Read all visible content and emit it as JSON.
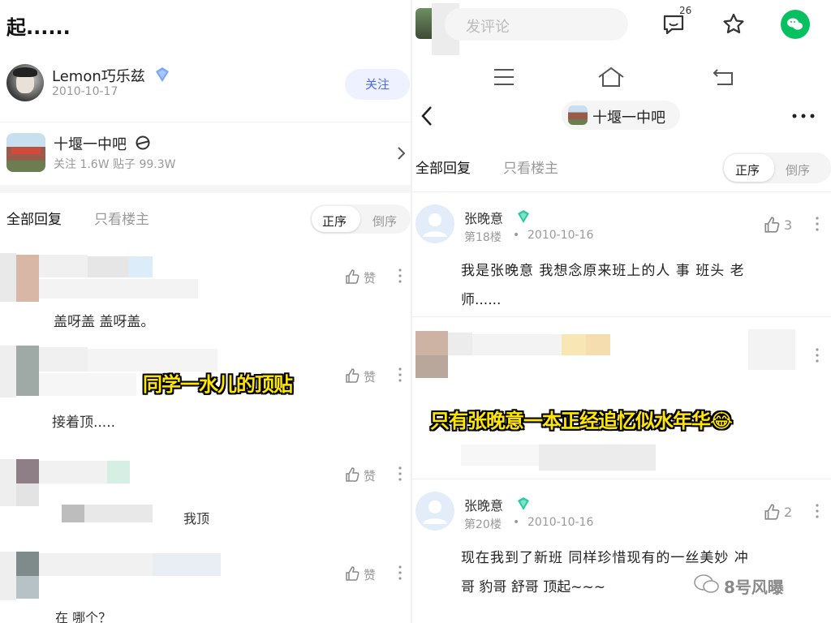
{
  "left": {
    "top_text": "起......",
    "author": {
      "name": "Lemon巧乐兹",
      "date": "2010-10-17",
      "follow_label": "关注"
    },
    "forum": {
      "name": "十堰一中吧",
      "stats": "关注 1.6W  贴子 99.3W"
    },
    "filters": {
      "all": "全部回复",
      "owner_only": "只看楼主",
      "order_asc": "正序",
      "order_desc": "倒序"
    },
    "comments": [
      {
        "text": "盖呀盖 盖呀盖。",
        "like": "赞"
      },
      {
        "text": "接着顶.....",
        "like": "赞"
      },
      {
        "text": "我顶",
        "like": "赞"
      },
      {
        "text": "在 哪个？",
        "like": "赞"
      }
    ],
    "overlay_caption": "同学一水儿的顶贴"
  },
  "right": {
    "comment_box_placeholder": "发评论",
    "comment_badge": "26",
    "forum_title": "十堰一中吧",
    "filters": {
      "all": "全部回复",
      "owner_only": "只看楼主",
      "order_asc": "正序",
      "order_desc": "倒序"
    },
    "posts": [
      {
        "name": "张晚意",
        "floor": "第18楼",
        "date": "2010-10-16",
        "likes": "3",
        "text_line1": "我是张晚意  我想念原来班上的人 事  班头 老",
        "text_line2": "师......"
      },
      {
        "name": "张晚意",
        "floor": "第20楼",
        "date": "2010-10-16",
        "likes": "2",
        "text_line1": "现在我到了新班  同样珍惜现有的一丝美妙  冲",
        "text_line2": "哥 豹哥 舒哥  顶起~~~"
      }
    ],
    "overlay_caption": "只有张晚意一本正经追忆似水年华😂",
    "watermark": "8号风曝"
  },
  "colors": {
    "accent_blue": "#3d7cf5",
    "badge_green": "#2dc9a0",
    "wechat_green": "#07c160",
    "caption_yellow": "#ffe600"
  },
  "icons": [
    "back-arrow-icon",
    "more-dots-icon",
    "emoji-comment-icon",
    "star-icon",
    "wechat-icon",
    "menu-icon",
    "home-icon",
    "return-icon",
    "thumbs-up-icon",
    "kebab-icon",
    "verified-badge-icon",
    "chevron-right-icon",
    "avatar-placeholder-icon"
  ]
}
